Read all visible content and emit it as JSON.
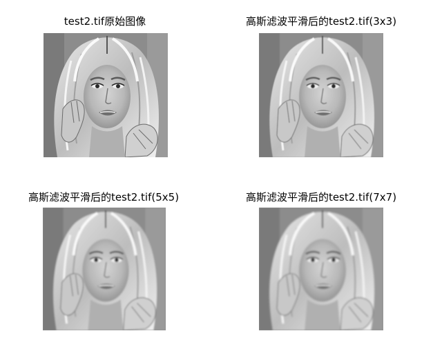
{
  "window": {
    "background": "#ffffff"
  },
  "subplots": [
    {
      "title": "test2.tif原始图像",
      "image_content": "grayscale portrait photo (original)",
      "blur": 0
    },
    {
      "title": "高斯滤波平滑后的test2.tif(3x3)",
      "image_content": "grayscale portrait photo (3x3 Gaussian smoothed)",
      "blur": 0.6
    },
    {
      "title": "高斯滤波平滑后的test2.tif(5x5)",
      "image_content": "grayscale portrait photo (5x5 Gaussian smoothed)",
      "blur": 1.0
    },
    {
      "title": "高斯滤波平滑后的test2.tif(7x7)",
      "image_content": "grayscale portrait photo (7x7 Gaussian smoothed)",
      "blur": 1.4
    }
  ]
}
